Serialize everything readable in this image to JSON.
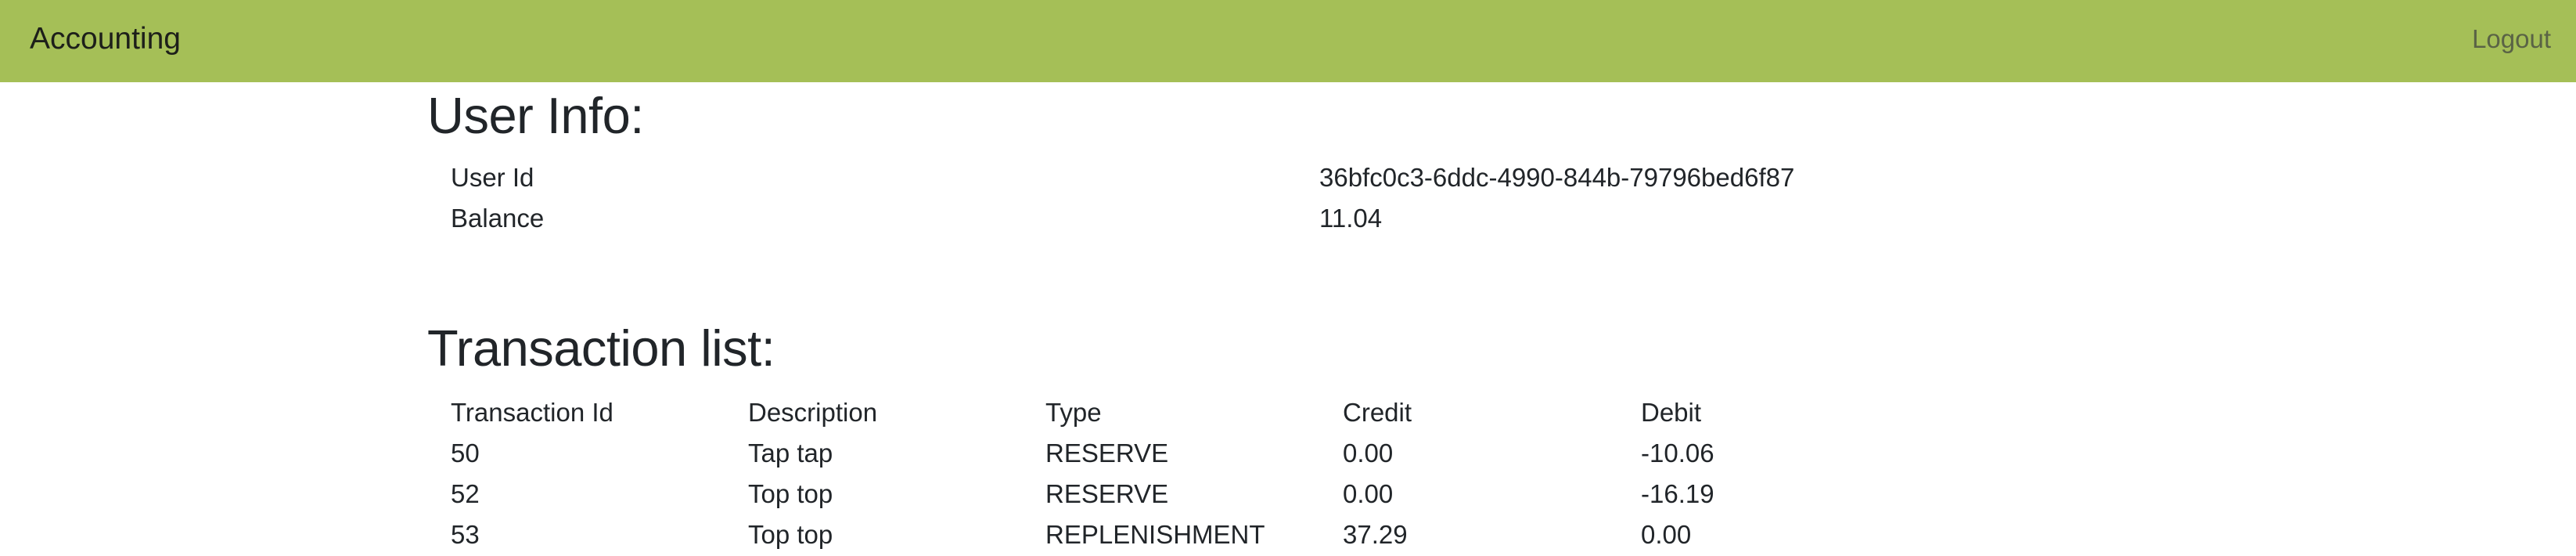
{
  "navbar": {
    "brand": "Accounting",
    "logout": "Logout",
    "color": "#a5bf57"
  },
  "user_info": {
    "heading": "User Info:",
    "rows": [
      {
        "label": "User Id",
        "value": "36bfc0c3-6ddc-4990-844b-79796bed6f87"
      },
      {
        "label": "Balance",
        "value": "11.04"
      }
    ]
  },
  "transactions": {
    "heading": "Transaction list:",
    "columns": [
      "Transaction Id",
      "Description",
      "Type",
      "Credit",
      "Debit"
    ],
    "rows": [
      [
        "50",
        "Tap tap",
        "RESERVE",
        "0.00",
        "-10.06"
      ],
      [
        "52",
        "Top top",
        "RESERVE",
        "0.00",
        "-16.19"
      ],
      [
        "53",
        "Top top",
        "REPLENISHMENT",
        "37.29",
        "0.00"
      ]
    ]
  }
}
